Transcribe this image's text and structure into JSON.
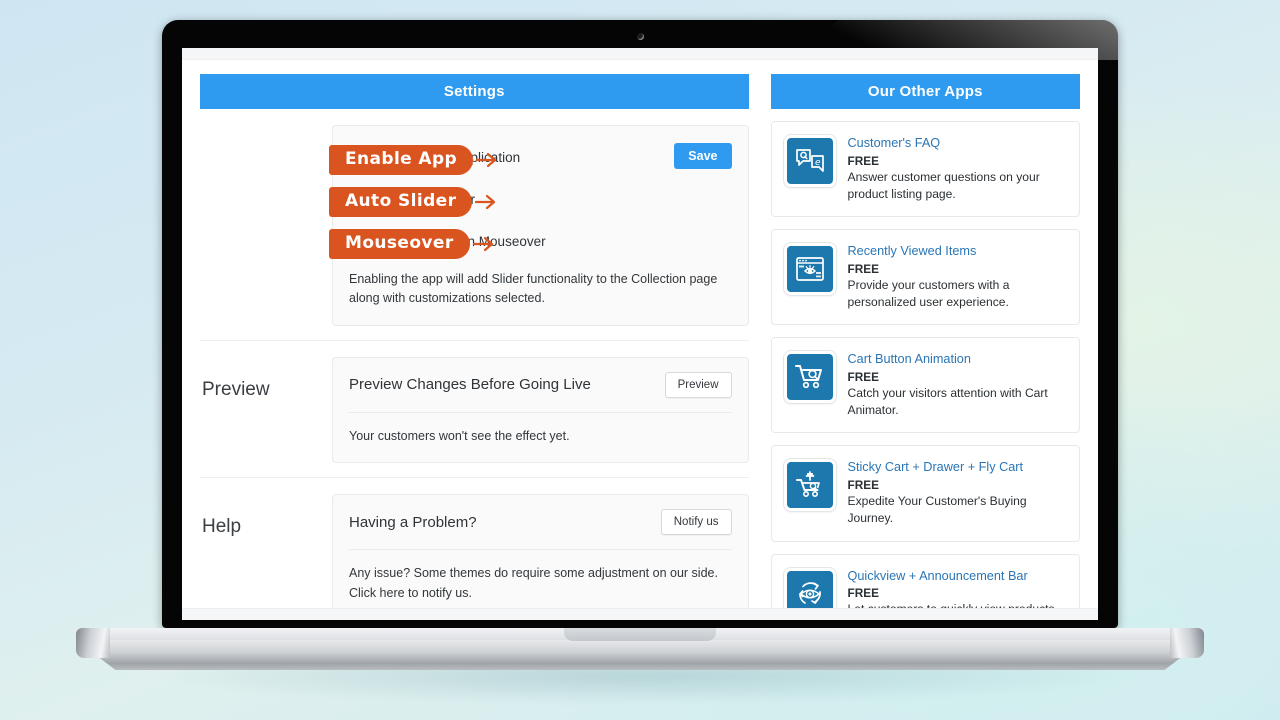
{
  "settings_panel": {
    "header": "Settings",
    "toggles": [
      {
        "label": "Enable Application",
        "state": "on",
        "callout": "Enable App"
      },
      {
        "label": "Auto Slider",
        "state": "off",
        "callout": "Auto Slider"
      },
      {
        "label": "Change on Mouseover",
        "state": "on",
        "callout": "Mouseover"
      }
    ],
    "save_label": "Save",
    "description": "Enabling the app will add Slider functionality to the Collection page along with customizations selected.",
    "preview": {
      "section_label": "Preview",
      "title": "Preview Changes Before Going Live",
      "button": "Preview",
      "body": "Your customers won't see the effect yet."
    },
    "help": {
      "section_label": "Help",
      "title": "Having a Problem?",
      "button": "Notify us",
      "body": "Any issue? Some themes do require some adjustment on our side. Click here to notify us."
    }
  },
  "other_apps": {
    "header": "Our Other Apps",
    "items": [
      {
        "name": "Customer's FAQ",
        "price": "FREE",
        "desc": "Answer customer questions on your product listing page.",
        "icon": "chat-bubbles-faq-icon"
      },
      {
        "name": "Recently Viewed Items",
        "price": "FREE",
        "desc": "Provide your customers with a personalized user experience.",
        "icon": "browser-window-eye-icon"
      },
      {
        "name": "Cart Button Animation",
        "price": "FREE",
        "desc": "Catch your visitors attention with Cart Animator.",
        "icon": "shopping-cart-icon"
      },
      {
        "name": "Sticky Cart + Drawer + Fly Cart",
        "price": "FREE",
        "desc": "Expedite Your Customer's Buying Journey.",
        "icon": "sticky-cart-pin-icon"
      },
      {
        "name": "Quickview + Announcement Bar",
        "price": "FREE",
        "desc": "Let customers to quickly view products and keep them updated.",
        "icon": "eye-refresh-icon"
      }
    ]
  },
  "colors": {
    "accent_blue": "#2e9bf0",
    "callout_orange": "#d9541e",
    "icon_blue": "#1c78ad",
    "link_blue": "#2a75b5"
  }
}
